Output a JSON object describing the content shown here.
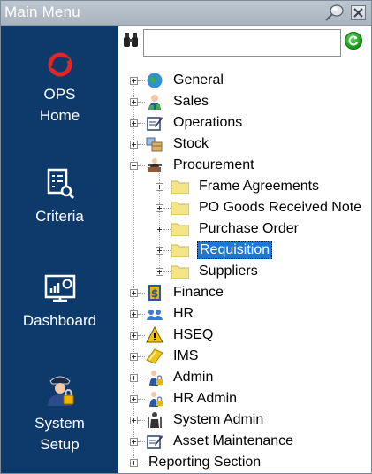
{
  "window": {
    "title": "Main Menu"
  },
  "sidebar": {
    "items": [
      {
        "label": "OPS\nHome",
        "icon": "ops-logo-icon"
      },
      {
        "label": "Criteria",
        "icon": "criteria-icon"
      },
      {
        "label": "Dashboard",
        "icon": "dashboard-icon"
      },
      {
        "label": "System\nSetup",
        "icon": "system-setup-icon"
      }
    ]
  },
  "search": {
    "value": "",
    "placeholder": ""
  },
  "tree": {
    "nodes": [
      {
        "label": "General",
        "icon": "globe-icon",
        "expanded": false
      },
      {
        "label": "Sales",
        "icon": "sales-icon",
        "expanded": false
      },
      {
        "label": "Operations",
        "icon": "operations-icon",
        "expanded": false
      },
      {
        "label": "Stock",
        "icon": "stock-icon",
        "expanded": false
      },
      {
        "label": "Procurement",
        "icon": "procurement-icon",
        "expanded": true,
        "children": [
          {
            "label": "Frame Agreements",
            "icon": "folder-icon"
          },
          {
            "label": "PO Goods Received Note",
            "icon": "folder-icon"
          },
          {
            "label": "Purchase Order",
            "icon": "folder-icon"
          },
          {
            "label": "Requisition",
            "icon": "folder-icon",
            "selected": true
          },
          {
            "label": "Suppliers",
            "icon": "folder-icon"
          }
        ]
      },
      {
        "label": "Finance",
        "icon": "finance-icon",
        "expanded": false
      },
      {
        "label": "HR",
        "icon": "hr-icon",
        "expanded": false
      },
      {
        "label": "HSEQ",
        "icon": "warning-icon",
        "expanded": false
      },
      {
        "label": "IMS",
        "icon": "ims-icon",
        "expanded": false
      },
      {
        "label": "Admin",
        "icon": "admin-icon",
        "expanded": false
      },
      {
        "label": "HR Admin",
        "icon": "hr-admin-icon",
        "expanded": false
      },
      {
        "label": "System Admin",
        "icon": "system-admin-icon",
        "expanded": false
      },
      {
        "label": "Asset Maintenance",
        "icon": "asset-maintenance-icon",
        "expanded": false
      },
      {
        "label": "Reporting Section",
        "icon": "",
        "expanded": false
      }
    ]
  },
  "colors": {
    "sidebar": "#0e3a6b",
    "selection": "#1e76d6",
    "titlebar": "#a9b4bf"
  }
}
